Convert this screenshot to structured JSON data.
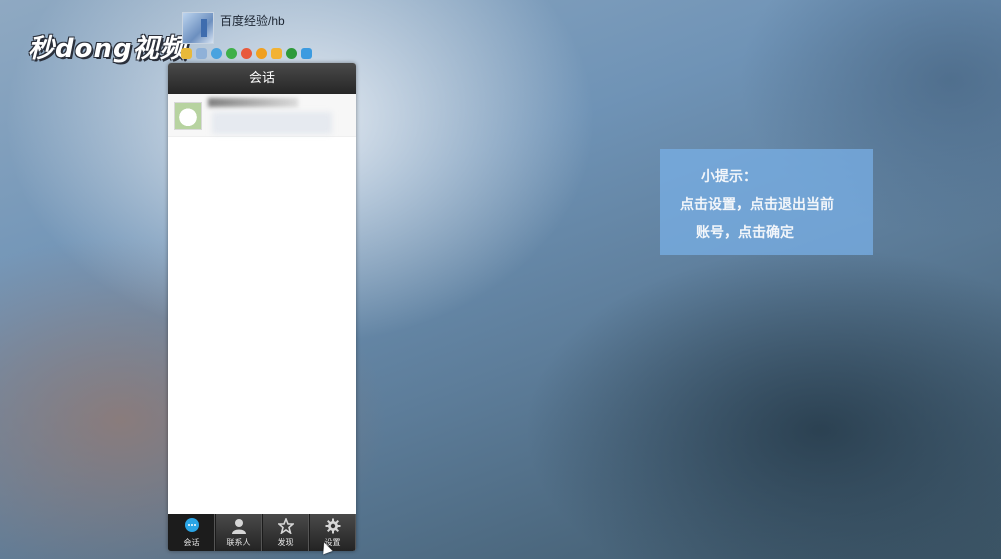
{
  "watermark": {
    "text": "秒dong视频"
  },
  "profile": {
    "name": "百度经验/hb"
  },
  "status_icons": [
    {
      "name": "star-icon",
      "color": "#e8b93a"
    },
    {
      "name": "mail-icon",
      "color": "#8fb1d8"
    },
    {
      "name": "zone-icon",
      "color": "#4aa3df"
    },
    {
      "name": "music-icon",
      "color": "#3fb04a"
    },
    {
      "name": "browser-icon",
      "color": "#e85a3c"
    },
    {
      "name": "pet-icon",
      "color": "#f0a020"
    },
    {
      "name": "gift-icon",
      "color": "#f2b233"
    },
    {
      "name": "clover-icon",
      "color": "#2e9a3a"
    },
    {
      "name": "photo-icon",
      "color": "#3c9be0"
    }
  ],
  "window": {
    "title": "会话"
  },
  "tabs": [
    {
      "label": "会话",
      "active": true
    },
    {
      "label": "联系人",
      "active": false
    },
    {
      "label": "发现",
      "active": false
    },
    {
      "label": "设置",
      "active": false
    }
  ],
  "hint": {
    "line1": "小提示：",
    "line2": "点击设置，点击退出当前",
    "line3": "账号，点击确定"
  }
}
